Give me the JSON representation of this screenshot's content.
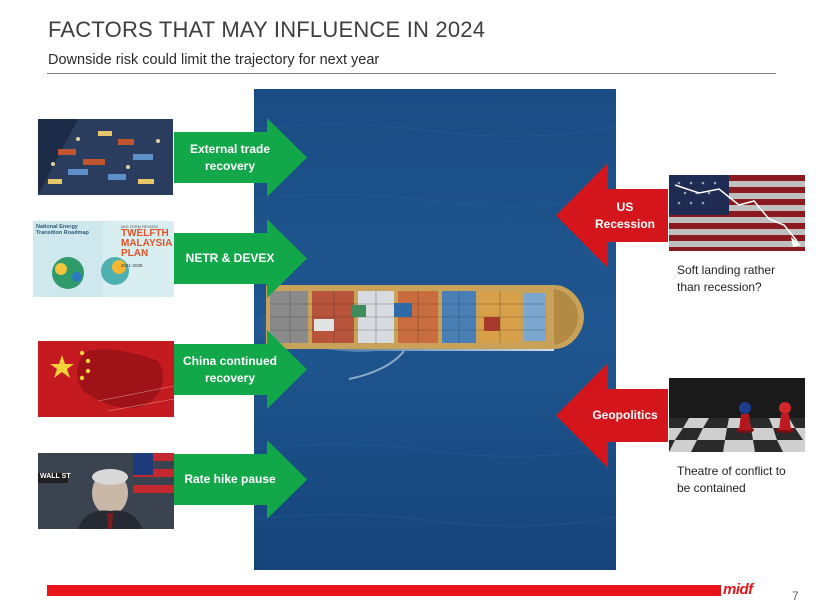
{
  "slide": {
    "title": "FACTORS THAT MAY INFLUENCE IN 2024",
    "subtitle": "Downside risk could limit the trajectory for next year",
    "page_number": "7"
  },
  "left_factors": [
    {
      "label": "External trade\nrecovery",
      "image": "port-containers-photo"
    },
    {
      "label": "NETR & DEVEX",
      "image": "netr-malaysia-plan-cover"
    },
    {
      "label": "China continued\nrecovery",
      "image": "china-flag-map"
    },
    {
      "label": "Rate hike pause",
      "image": "fed-chair-photo"
    }
  ],
  "right_factors": [
    {
      "label": "US\nRecession",
      "image": "us-flag-falling-chart",
      "caption": "Soft landing rather\nthan recession?"
    },
    {
      "label": "Geopolitics",
      "image": "chess-pawns-flags",
      "caption": "Theatre of conflict to\nbe contained"
    }
  ],
  "thumbnail_text": {
    "netr_left": "National Energy\nTransition Roadmap",
    "plan_small": "MID-TERM REVIEW",
    "plan_big": "TWELFTH\nMALAYSIA\nPLAN",
    "plan_years": "2021-2025",
    "wall_st": "WALL ST"
  },
  "footer": {
    "logo": "midf"
  },
  "colors": {
    "green_arrow": "#12a84a",
    "red_arrow": "#d4151c",
    "footer_red": "#e8141c",
    "sea": "#1f4e86"
  }
}
